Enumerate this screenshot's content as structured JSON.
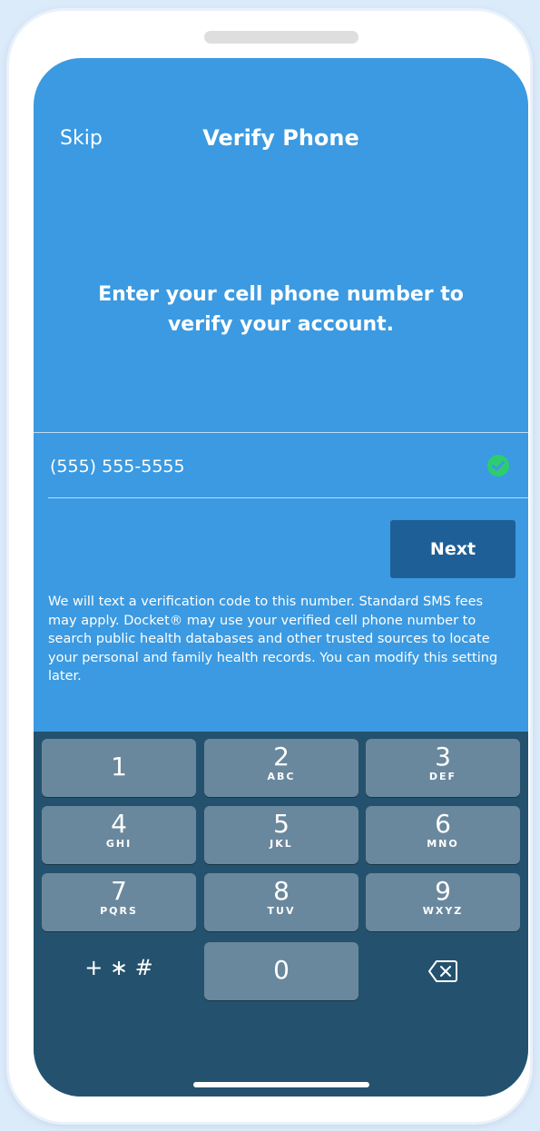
{
  "nav": {
    "skip_label": "Skip",
    "title": "Verify Phone"
  },
  "prompt": "Enter your cell phone number to verify your account.",
  "phone_field": {
    "value": "(555) 555-5555",
    "valid_icon": "check-circle-icon"
  },
  "next_label": "Next",
  "disclaimer": "We will text a verification code to this number. Standard SMS fees may apply. Docket® may use your verified cell phone number to search public health databases and other trusted sources to locate your personal and family health records. You can modify this setting later.",
  "keypad": {
    "keys": [
      {
        "digit": "1",
        "letters": ""
      },
      {
        "digit": "2",
        "letters": "ABC"
      },
      {
        "digit": "3",
        "letters": "DEF"
      },
      {
        "digit": "4",
        "letters": "GHI"
      },
      {
        "digit": "5",
        "letters": "JKL"
      },
      {
        "digit": "6",
        "letters": "MNO"
      },
      {
        "digit": "7",
        "letters": "PQRS"
      },
      {
        "digit": "8",
        "letters": "TUV"
      },
      {
        "digit": "9",
        "letters": "WXYZ"
      },
      {
        "digit": "0",
        "letters": ""
      }
    ],
    "symbols_label": "+ ∗ #",
    "delete_icon": "backspace-icon"
  },
  "colors": {
    "screen_bg": "#3b9ae1",
    "button_bg": "#1f5f97",
    "keyboard_bg": "#24526e",
    "key_bg": "#6a889d",
    "check_green": "#2ecc71"
  }
}
